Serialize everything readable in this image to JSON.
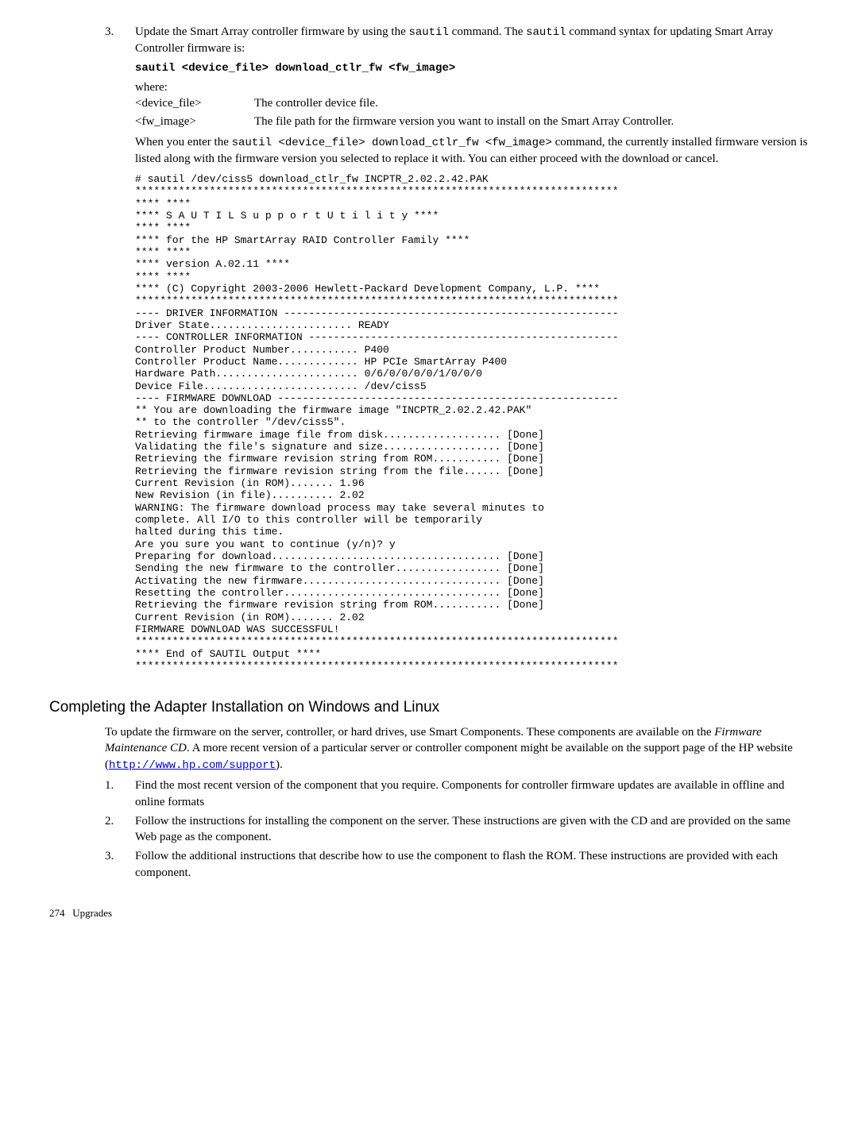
{
  "step3": {
    "num": "3.",
    "text_a": "Update the Smart Array controller firmware by using the ",
    "cmd_a": "sautil",
    "text_b": " command. The ",
    "cmd_b": "sautil",
    "text_c": " command syntax for updating Smart Array Controller firmware is:",
    "command": "sautil <device_file> download_ctlr_fw <fw_image>",
    "where": "where:",
    "param1_name": "<device_file>",
    "param1_desc": "The controller device file.",
    "param2_name": "<fw_image>",
    "param2_desc": "The file path for the firmware version you want to install on the Smart Array Controller.",
    "when_a": "When you enter the ",
    "when_cmd": "sautil <device_file> download_ctlr_fw <fw_image>",
    "when_b": " command, the currently installed firmware version is listed along with the firmware version you selected to replace it with. You can either proceed with the download or cancel."
  },
  "codeblock": "# sautil /dev/ciss5 download_ctlr_fw INCPTR_2.02.2.42.PAK\n******************************************************************************\n**** ****\n**** S A U T I L S u p p o r t U t i l i t y ****\n**** ****\n**** for the HP SmartArray RAID Controller Family ****\n**** ****\n**** version A.02.11 ****\n**** ****\n**** (C) Copyright 2003-2006 Hewlett-Packard Development Company, L.P. ****\n******************************************************************************\n---- DRIVER INFORMATION ------------------------------------------------------\nDriver State....................... READY\n---- CONTROLLER INFORMATION --------------------------------------------------\nController Product Number........... P400\nController Product Name............. HP PCIe SmartArray P400\nHardware Path....................... 0/6/0/0/0/0/1/0/0/0\nDevice File......................... /dev/ciss5\n---- FIRMWARE DOWNLOAD -------------------------------------------------------\n** You are downloading the firmware image \"INCPTR_2.02.2.42.PAK\"\n** to the controller \"/dev/ciss5\".\nRetrieving firmware image file from disk................... [Done]\nValidating the file's signature and size................... [Done]\nRetrieving the firmware revision string from ROM........... [Done]\nRetrieving the firmware revision string from the file...... [Done]\nCurrent Revision (in ROM)....... 1.96\nNew Revision (in file).......... 2.02\nWARNING: The firmware download process may take several minutes to\ncomplete. All I/O to this controller will be temporarily\nhalted during this time.\nAre you sure you want to continue (y/n)? y\nPreparing for download..................................... [Done]\nSending the new firmware to the controller................. [Done]\nActivating the new firmware................................ [Done]\nResetting the controller................................... [Done]\nRetrieving the firmware revision string from ROM........... [Done]\nCurrent Revision (in ROM)....... 2.02\nFIRMWARE DOWNLOAD WAS SUCCESSFUL!\n******************************************************************************\n**** End of SAUTIL Output ****\n******************************************************************************",
  "section2": {
    "heading": "Completing the Adapter Installation on Windows and Linux",
    "intro_a": "To update the firmware on the server, controller, or hard drives, use Smart Components. These components are available on the ",
    "intro_ital": "Firmware Maintenance CD",
    "intro_b": ". A more recent version of a particular server or controller component might be available on the support page of the HP website (",
    "link": "http://www.hp.com/support",
    "intro_c": ").",
    "s1_num": "1.",
    "s1": "Find the most recent version of the component that you require. Components for controller firmware updates are available in offline and online formats",
    "s2_num": "2.",
    "s2": "Follow the instructions for installing the component on the server. These instructions are given with the CD and are provided on the same Web page as the component.",
    "s3_num": "3.",
    "s3": "Follow the additional instructions that describe how to use the component to flash the ROM. These instructions are provided with each component."
  },
  "footer": {
    "page": "274",
    "chapter": "Upgrades"
  }
}
